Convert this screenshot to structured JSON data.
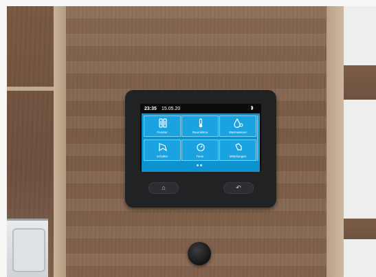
{
  "statusbar": {
    "time": "23:35",
    "date": "15.05.20",
    "bluetooth_icon": "bluetooth-icon"
  },
  "tiles": [
    {
      "label": "Fenster",
      "icon": "window-icon"
    },
    {
      "label": "Raumklima",
      "icon": "thermometer-icon"
    },
    {
      "label": "Warmwasser",
      "icon": "water-drop-icon"
    },
    {
      "label": "Schalter",
      "icon": "switch-icon"
    },
    {
      "label": "Timer",
      "icon": "timer-icon"
    },
    {
      "label": "Mitteilungen",
      "icon": "bell-icon"
    }
  ],
  "hardware_buttons": {
    "home": "⌂",
    "back": "↶"
  },
  "colors": {
    "screen": "#0e93d1",
    "tile": "#1aa3e0",
    "device": "#212224"
  }
}
